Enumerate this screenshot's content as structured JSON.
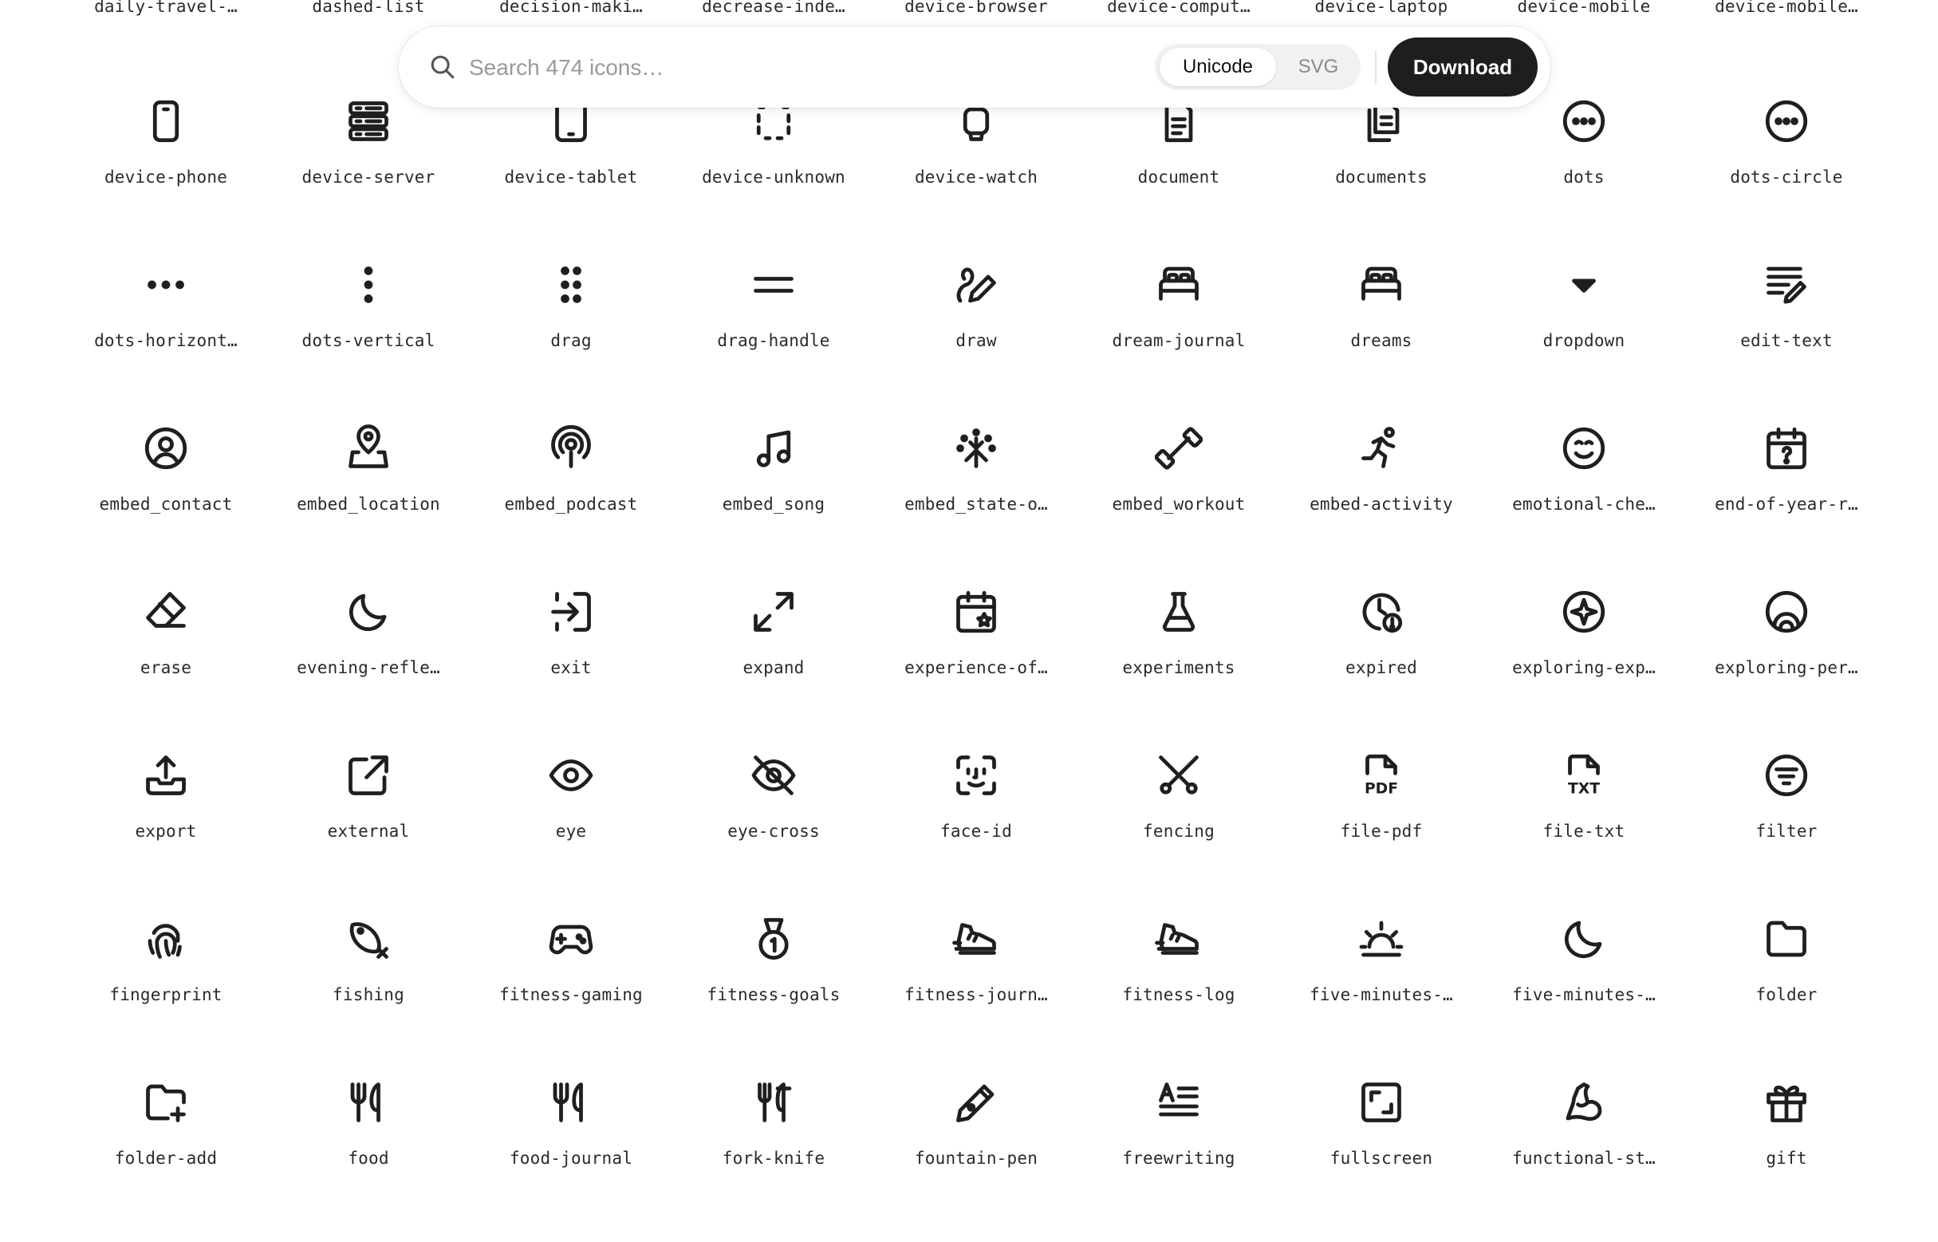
{
  "search": {
    "placeholder": "Search 474 icons…",
    "modes": [
      "Unicode",
      "SVG"
    ],
    "active_mode": "Unicode",
    "download_label": "Download"
  },
  "top_partial_labels": [
    "daily-travel-…",
    "dashed-list",
    "decision-maki…",
    "decrease-inde…",
    "device-browser",
    "device-comput…",
    "device-laptop",
    "device-mobile",
    "device-mobile…"
  ],
  "icons": [
    {
      "label": "device-phone",
      "icon": "device-phone-icon"
    },
    {
      "label": "device-server",
      "icon": "device-server-icon"
    },
    {
      "label": "device-tablet",
      "icon": "device-tablet-icon"
    },
    {
      "label": "device-unknown",
      "icon": "device-unknown-icon"
    },
    {
      "label": "device-watch",
      "icon": "device-watch-icon"
    },
    {
      "label": "document",
      "icon": "document-icon"
    },
    {
      "label": "documents",
      "icon": "documents-icon"
    },
    {
      "label": "dots",
      "icon": "dots-icon"
    },
    {
      "label": "dots-circle",
      "icon": "dots-circle-icon"
    },
    {
      "label": "dots-horizont…",
      "icon": "dots-horizontal-icon"
    },
    {
      "label": "dots-vertical",
      "icon": "dots-vertical-icon"
    },
    {
      "label": "drag",
      "icon": "drag-icon"
    },
    {
      "label": "drag-handle",
      "icon": "drag-handle-icon"
    },
    {
      "label": "draw",
      "icon": "draw-icon"
    },
    {
      "label": "dream-journal",
      "icon": "bed-icon"
    },
    {
      "label": "dreams",
      "icon": "bed-icon"
    },
    {
      "label": "dropdown",
      "icon": "dropdown-icon"
    },
    {
      "label": "edit-text",
      "icon": "edit-text-icon"
    },
    {
      "label": "embed_contact",
      "icon": "contact-icon"
    },
    {
      "label": "embed_location",
      "icon": "location-icon"
    },
    {
      "label": "embed_podcast",
      "icon": "podcast-icon"
    },
    {
      "label": "embed_song",
      "icon": "music-note-icon"
    },
    {
      "label": "embed_state-o…",
      "icon": "sparkle-burst-icon"
    },
    {
      "label": "embed_workout",
      "icon": "dumbbell-icon"
    },
    {
      "label": "embed-activity",
      "icon": "running-icon"
    },
    {
      "label": "emotional-che…",
      "icon": "smile-icon"
    },
    {
      "label": "end-of-year-r…",
      "icon": "calendar-question-icon"
    },
    {
      "label": "erase",
      "icon": "eraser-icon"
    },
    {
      "label": "evening-refle…",
      "icon": "moon-icon"
    },
    {
      "label": "exit",
      "icon": "exit-icon"
    },
    {
      "label": "expand",
      "icon": "expand-icon"
    },
    {
      "label": "experience-of…",
      "icon": "calendar-star-icon"
    },
    {
      "label": "experiments",
      "icon": "flask-icon"
    },
    {
      "label": "expired",
      "icon": "clock-alert-icon"
    },
    {
      "label": "exploring-exp…",
      "icon": "compass-sparkle-icon"
    },
    {
      "label": "exploring-per…",
      "icon": "rings-icon"
    },
    {
      "label": "export",
      "icon": "export-icon"
    },
    {
      "label": "external",
      "icon": "external-link-icon"
    },
    {
      "label": "eye",
      "icon": "eye-icon"
    },
    {
      "label": "eye-cross",
      "icon": "eye-cross-icon"
    },
    {
      "label": "face-id",
      "icon": "face-id-icon"
    },
    {
      "label": "fencing",
      "icon": "fencing-icon"
    },
    {
      "label": "file-pdf",
      "icon": "file-pdf-icon"
    },
    {
      "label": "file-txt",
      "icon": "file-txt-icon"
    },
    {
      "label": "filter",
      "icon": "filter-icon"
    },
    {
      "label": "fingerprint",
      "icon": "fingerprint-icon"
    },
    {
      "label": "fishing",
      "icon": "fish-icon"
    },
    {
      "label": "fitness-gaming",
      "icon": "gamepad-icon"
    },
    {
      "label": "fitness-goals",
      "icon": "medal-icon"
    },
    {
      "label": "fitness-journ…",
      "icon": "sneaker-icon"
    },
    {
      "label": "fitness-log",
      "icon": "sneaker-icon"
    },
    {
      "label": "five-minutes-…",
      "icon": "sunrise-icon"
    },
    {
      "label": "five-minutes-…",
      "icon": "moon-icon"
    },
    {
      "label": "folder",
      "icon": "folder-icon"
    },
    {
      "label": "folder-add",
      "icon": "folder-add-icon"
    },
    {
      "label": "food",
      "icon": "utensils-icon"
    },
    {
      "label": "food-journal",
      "icon": "utensils-icon"
    },
    {
      "label": "fork-knife",
      "icon": "fork-knife-icon"
    },
    {
      "label": "fountain-pen",
      "icon": "fountain-pen-icon"
    },
    {
      "label": "freewriting",
      "icon": "freewriting-icon"
    },
    {
      "label": "fullscreen",
      "icon": "fullscreen-icon"
    },
    {
      "label": "functional-st…",
      "icon": "muscle-icon"
    },
    {
      "label": "gift",
      "icon": "gift-icon"
    }
  ]
}
